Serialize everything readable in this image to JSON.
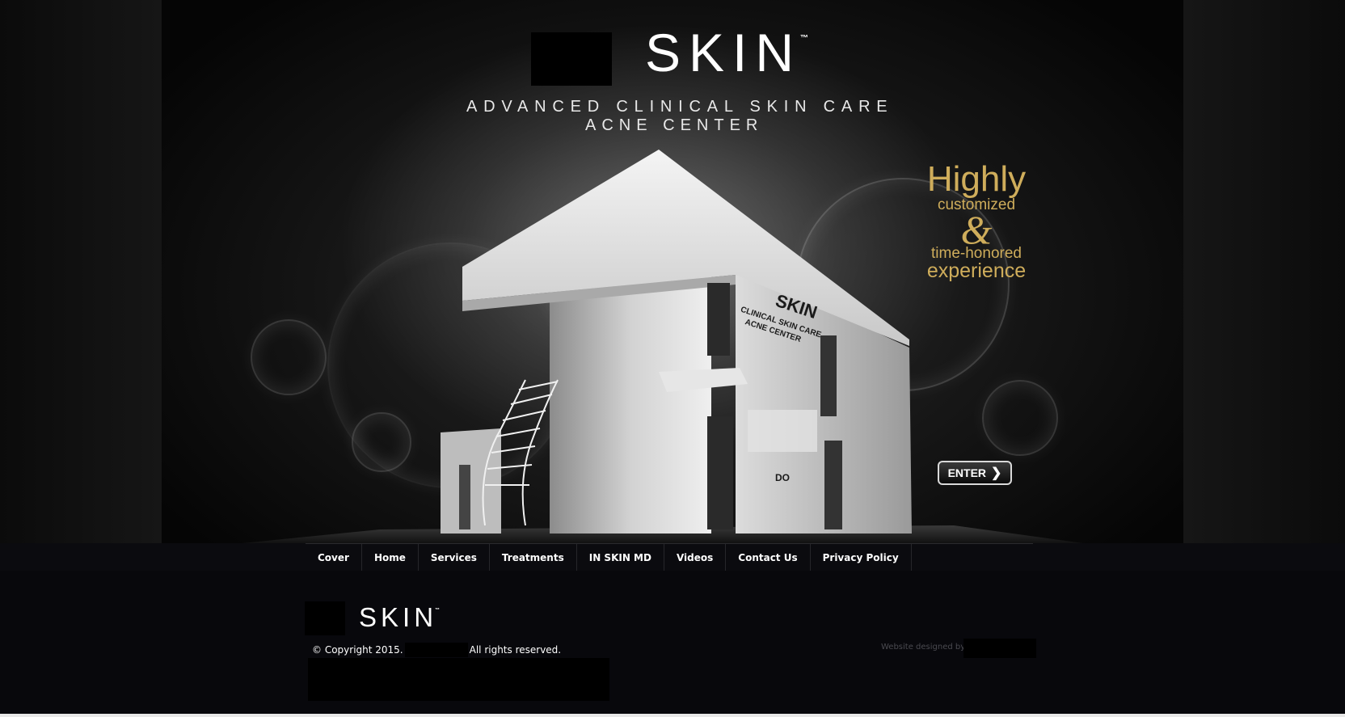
{
  "logo": {
    "text": "SKIN",
    "tm": "™"
  },
  "tagline": {
    "line1": "ADVANCED CLINICAL SKIN CARE",
    "line2": "ACNE CENTER"
  },
  "promo": {
    "line1": "Highly",
    "line2": "customized",
    "line3": "&",
    "line4": "time-honored",
    "line5": "experience",
    "color": "#cfad5b"
  },
  "building_sign": {
    "line1": "SKIN",
    "line2": "CLINICAL SKIN CARE",
    "line3": "ACNE CENTER",
    "number": "DO"
  },
  "enter_button": {
    "label": "ENTER",
    "icon": "chevron-right-icon"
  },
  "nav": {
    "items": [
      {
        "label": "Cover"
      },
      {
        "label": "Home"
      },
      {
        "label": "Services"
      },
      {
        "label": "Treatments"
      },
      {
        "label": "IN SKIN MD"
      },
      {
        "label": "Videos"
      },
      {
        "label": "Contact Us"
      },
      {
        "label": "Privacy Policy"
      }
    ]
  },
  "footer": {
    "logo_text": "SKIN",
    "logo_tm": "™",
    "copyright_prefix": "© Copyright 2015.",
    "copyright_suffix": "All rights reserved.",
    "designed_by": "Website designed by"
  }
}
